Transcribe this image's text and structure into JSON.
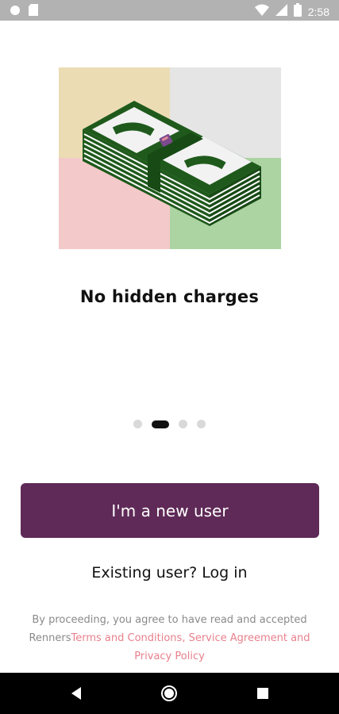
{
  "status_bar": {
    "time": "2:58",
    "icons": [
      "circle-icon",
      "sd-card-icon",
      "wifi-icon",
      "signal-icon",
      "battery-icon"
    ]
  },
  "onboarding": {
    "illustration": "stack-of-cash",
    "title": "No hidden charges",
    "pager": {
      "total": 4,
      "active_index": 1
    }
  },
  "actions": {
    "new_user_label": "I'm a new user",
    "login_label": "Existing user? Log in"
  },
  "terms": {
    "prefix": "By proceeding, you agree to have read and accepted Renners",
    "link_text": "Terms and Conditions, Service Agreement and Privacy Policy"
  },
  "colors": {
    "primary": "#5f2a57",
    "link": "#e8808c",
    "cash_green": "#1f5a1c"
  },
  "nav_bar": {
    "icons": [
      "back-icon",
      "home-icon",
      "recents-icon"
    ]
  }
}
